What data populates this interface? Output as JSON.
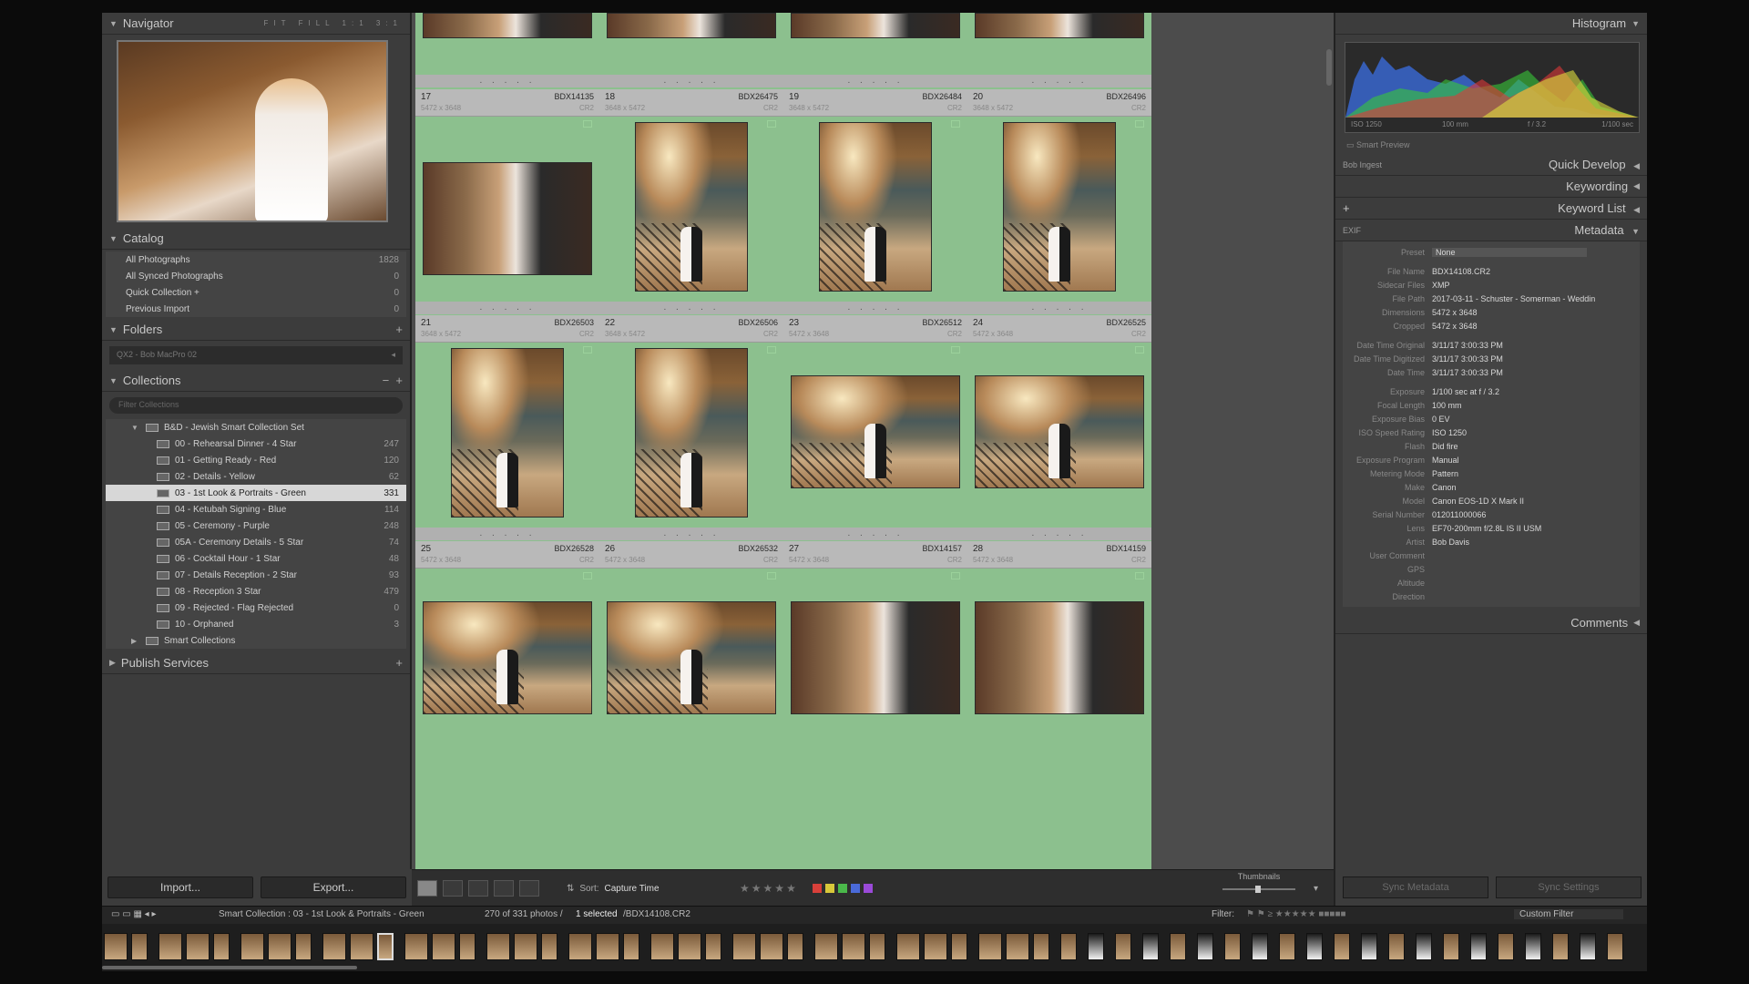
{
  "left": {
    "navigator": {
      "title": "Navigator",
      "zoom": "FIT FILL 1:1 3:1"
    },
    "catalog": {
      "title": "Catalog",
      "items": [
        {
          "label": "All Photographs",
          "count": "1828"
        },
        {
          "label": "All Synced Photographs",
          "count": "0"
        },
        {
          "label": "Quick Collection +",
          "count": "0"
        },
        {
          "label": "Previous Import",
          "count": "0"
        }
      ]
    },
    "folders": {
      "title": "Folders",
      "drive": "QX2 - Bob MacPro 02"
    },
    "collections": {
      "title": "Collections",
      "search_placeholder": "Filter Collections",
      "set": "B&D - Jewish Smart Collection Set",
      "items": [
        {
          "label": "00 - Rehearsal Dinner - 4 Star",
          "count": "247"
        },
        {
          "label": "01 - Getting Ready - Red",
          "count": "120"
        },
        {
          "label": "02 - Details - Yellow",
          "count": "62"
        },
        {
          "label": "03 - 1st Look & Portraits - Green",
          "count": "331"
        },
        {
          "label": "04 - Ketubah Signing - Blue",
          "count": "114"
        },
        {
          "label": "05 - Ceremony - Purple",
          "count": "248"
        },
        {
          "label": "05A - Ceremony Details - 5 Star",
          "count": "74"
        },
        {
          "label": "06 - Cocktail Hour - 1 Star",
          "count": "48"
        },
        {
          "label": "07 - Details Reception - 2 Star",
          "count": "93"
        },
        {
          "label": "08 - Reception 3 Star",
          "count": "479"
        },
        {
          "label": "09 - Rejected - Flag Rejected",
          "count": "0"
        },
        {
          "label": "10 - Orphaned",
          "count": "3"
        }
      ],
      "smart": "Smart Collections"
    },
    "publish": {
      "title": "Publish Services"
    },
    "import_label": "Import...",
    "export_label": "Export..."
  },
  "grid": {
    "cells": [
      {
        "num": "17",
        "file": "BDX14135",
        "dims": "5472 x 3648",
        "ext": "CR2"
      },
      {
        "num": "18",
        "file": "BDX26475",
        "dims": "3648 x 5472",
        "ext": "CR2"
      },
      {
        "num": "19",
        "file": "BDX26484",
        "dims": "3648 x 5472",
        "ext": "CR2"
      },
      {
        "num": "20",
        "file": "BDX26496",
        "dims": "3648 x 5472",
        "ext": "CR2"
      },
      {
        "num": "21",
        "file": "BDX26503",
        "dims": "3648 x 5472",
        "ext": "CR2"
      },
      {
        "num": "22",
        "file": "BDX26506",
        "dims": "3648 x 5472",
        "ext": "CR2"
      },
      {
        "num": "23",
        "file": "BDX26512",
        "dims": "5472 x 3648",
        "ext": "CR2"
      },
      {
        "num": "24",
        "file": "BDX26525",
        "dims": "5472 x 3648",
        "ext": "CR2"
      },
      {
        "num": "25",
        "file": "BDX26528",
        "dims": "5472 x 3648",
        "ext": "CR2"
      },
      {
        "num": "26",
        "file": "BDX26532",
        "dims": "5472 x 3648",
        "ext": "CR2"
      },
      {
        "num": "27",
        "file": "BDX14157",
        "dims": "5472 x 3648",
        "ext": "CR2"
      },
      {
        "num": "28",
        "file": "BDX14159",
        "dims": "5472 x 3648",
        "ext": "CR2"
      }
    ],
    "footer_dots": ". . . . ."
  },
  "toolbar": {
    "sort_label": "Sort:",
    "sort_value": "Capture Time",
    "thumbnails_label": "Thumbnails",
    "colors": [
      "#d8403a",
      "#d8c83a",
      "#4ab84a",
      "#4a6ad8",
      "#9a4ad8"
    ]
  },
  "right": {
    "histogram": {
      "title": "Histogram",
      "iso": "ISO 1250",
      "focal": "100 mm",
      "aperture": "f / 3.2",
      "shutter": "1/100 sec"
    },
    "smart_preview": "Smart Preview",
    "quick_develop": {
      "title": "Quick Develop",
      "preset": "Bob Ingest"
    },
    "keywording": "Keywording",
    "keyword_list": "Keyword List",
    "metadata": {
      "title": "Metadata",
      "mode": "EXIF",
      "preset_label": "Preset",
      "preset_value": "None",
      "rows": [
        {
          "k": "File Name",
          "v": "BDX14108.CR2"
        },
        {
          "k": "Sidecar Files",
          "v": "XMP"
        },
        {
          "k": "File Path",
          "v": "2017-03-11 - Schuster - Somerman - Weddin"
        },
        {
          "k": "Dimensions",
          "v": "5472 x 3648"
        },
        {
          "k": "Cropped",
          "v": "5472 x 3648"
        },
        {
          "k": "",
          "v": ""
        },
        {
          "k": "Date Time Original",
          "v": "3/11/17 3:00:33 PM"
        },
        {
          "k": "Date Time Digitized",
          "v": "3/11/17 3:00:33 PM"
        },
        {
          "k": "Date Time",
          "v": "3/11/17 3:00:33 PM"
        },
        {
          "k": "",
          "v": ""
        },
        {
          "k": "Exposure",
          "v": "1/100 sec at f / 3.2"
        },
        {
          "k": "Focal Length",
          "v": "100 mm"
        },
        {
          "k": "Exposure Bias",
          "v": "0 EV"
        },
        {
          "k": "ISO Speed Rating",
          "v": "ISO 1250"
        },
        {
          "k": "Flash",
          "v": "Did fire"
        },
        {
          "k": "Exposure Program",
          "v": "Manual"
        },
        {
          "k": "Metering Mode",
          "v": "Pattern"
        },
        {
          "k": "Make",
          "v": "Canon"
        },
        {
          "k": "Model",
          "v": "Canon EOS-1D X Mark II"
        },
        {
          "k": "Serial Number",
          "v": "012011000066"
        },
        {
          "k": "Lens",
          "v": "EF70-200mm f/2.8L IS II USM"
        },
        {
          "k": "Artist",
          "v": "Bob Davis"
        },
        {
          "k": "User Comment",
          "v": ""
        },
        {
          "k": "GPS",
          "v": ""
        },
        {
          "k": "Altitude",
          "v": ""
        },
        {
          "k": "Direction",
          "v": ""
        }
      ]
    },
    "comments": "Comments",
    "sync_metadata": "Sync Metadata",
    "sync_settings": "Sync Settings"
  },
  "filmstrip": {
    "path": "Smart Collection : 03 - 1st Look & Portraits - Green",
    "count_text": "270 of 331 photos /",
    "selected": "1 selected",
    "file": "/BDX14108.CR2",
    "filter_label": "Filter:",
    "filter_value": "Custom Filter"
  }
}
